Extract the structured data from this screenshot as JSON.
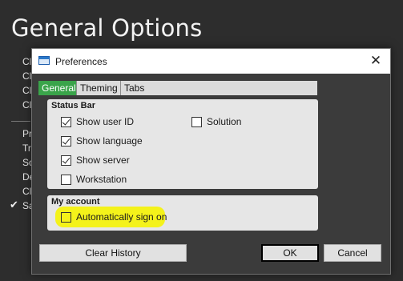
{
  "background": {
    "title": "General Options",
    "items": [
      "Cl",
      "Cl",
      "Cl",
      "Cl",
      "Pr",
      "Tr",
      "Sc",
      "De",
      "Cl",
      "Sa"
    ],
    "checkmark": "✔"
  },
  "dialog": {
    "title": "Preferences",
    "close_glyph": "✕",
    "tabs": [
      {
        "label": "General",
        "active": true
      },
      {
        "label": "Theming",
        "active": false
      },
      {
        "label": "Tabs",
        "active": false
      }
    ],
    "status_bar": {
      "label": "Status Bar",
      "options": [
        {
          "label": "Show user ID",
          "checked": true
        },
        {
          "label": "Show language",
          "checked": true
        },
        {
          "label": "Show server",
          "checked": true
        },
        {
          "label": "Workstation",
          "checked": false
        },
        {
          "label": "Solution",
          "checked": false
        }
      ]
    },
    "my_account": {
      "label": "My account",
      "options": [
        {
          "label": "Automatically sign on",
          "checked": false
        }
      ]
    },
    "buttons": {
      "clear_history": "Clear History",
      "ok": "OK",
      "cancel": "Cancel"
    }
  },
  "colors": {
    "active_tab": "#3aa44a",
    "highlight": "#f4f21a",
    "background": "#2d2d2d"
  }
}
